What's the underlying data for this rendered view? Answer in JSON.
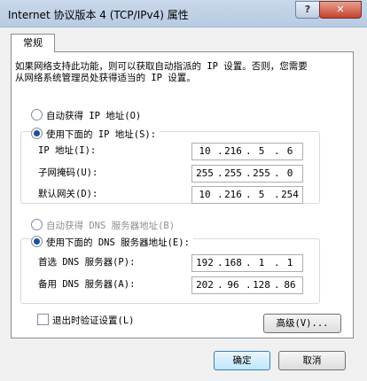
{
  "window": {
    "title": "Internet 协议版本 4 (TCP/IPv4) 属性",
    "help_label": "?",
    "close_label": "✕"
  },
  "tab": {
    "label": "常规"
  },
  "description": "如果网络支持此功能，则可以获取自动指派的 IP 设置。否则，您需要从网络系统管理员处获得适当的 IP 设置。",
  "ip": {
    "auto_label": "自动获得 IP 地址(O)",
    "manual_label": "使用下面的 IP 地址(S):",
    "selected": "manual",
    "fields": [
      {
        "label": "IP 地址(I):",
        "octets": [
          "10",
          "216",
          "5",
          "6"
        ]
      },
      {
        "label": "子网掩码(U):",
        "octets": [
          "255",
          "255",
          "255",
          "0"
        ]
      },
      {
        "label": "默认网关(D):",
        "octets": [
          "10",
          "216",
          "5",
          "254"
        ]
      }
    ]
  },
  "dns": {
    "auto_label": "自动获得 DNS 服务器地址(B)",
    "manual_label": "使用下面的 DNS 服务器地址(E):",
    "selected": "manual",
    "fields": [
      {
        "label": "首选 DNS 服务器(P):",
        "octets": [
          "192",
          "168",
          "1",
          "1"
        ]
      },
      {
        "label": "备用 DNS 服务器(A):",
        "octets": [
          "202",
          "96",
          "128",
          "86"
        ]
      }
    ]
  },
  "validate_label": "退出时验证设置(L)",
  "buttons": {
    "advanced": "高级(V)...",
    "ok": "确定",
    "cancel": "取消"
  }
}
